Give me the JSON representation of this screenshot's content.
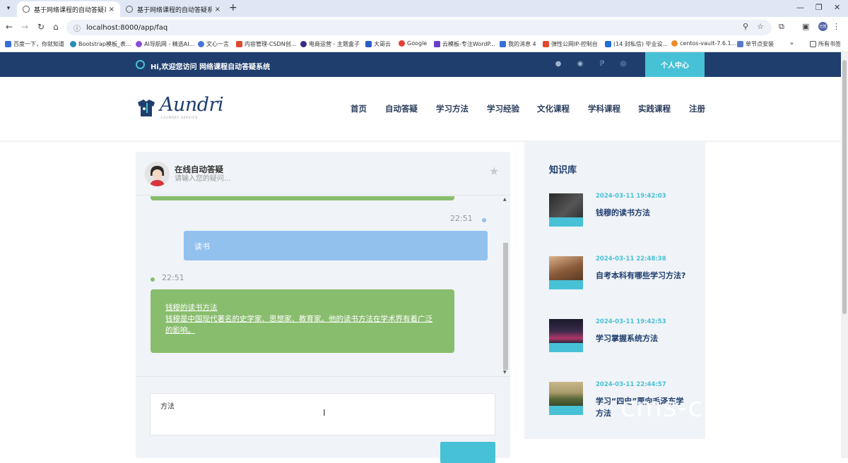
{
  "browser": {
    "tabs": [
      {
        "title": "基于网络课程的自动答疑系统",
        "active": true
      },
      {
        "title": "基于网络课程的自动答疑系统",
        "active": false
      }
    ],
    "new_tab": "+",
    "close": "×",
    "url": "localhost:8000/app/faq",
    "bookmarks": [
      "百度一下，你就知道",
      "Bootstrap模板_表...",
      "AI导航网 - 精选AI...",
      "文心一言",
      "内容管理-CSDN创...",
      "电商运营 - 主题盒子",
      "大哥云",
      "Google",
      "云模板-专注WordP...",
      "我的消息 4",
      "弹性公网IP-控制台",
      "(14 封私信) 毕业设...",
      "centos-vault-7.6.1...",
      "单节点安装"
    ],
    "bookmarks_more": "»",
    "all_bookmarks": "所有书签",
    "profile": "已暂"
  },
  "topbar": {
    "welcome": "Hi,欢迎您访问 网络课程自动答疑系统",
    "user_center": "个人中心",
    "social_icons": [
      "qq-icon",
      "wechat-icon",
      "pinterest-icon",
      "instagram-icon"
    ]
  },
  "header": {
    "logo_text": "Aundri",
    "logo_sub": "LAUNDRY SERVICE",
    "nav": [
      "首页",
      "自动答疑",
      "学习方法",
      "学习经验",
      "文化课程",
      "学科课程",
      "实践课程",
      "注册"
    ]
  },
  "chat": {
    "title": "在线自动答疑",
    "subtitle": "请输入您的疑问...",
    "messages": [
      {
        "side": "right",
        "time": "22:51",
        "text": "读书"
      },
      {
        "side": "left",
        "time": "22:51",
        "lines": [
          "钱穆的读书方法",
          "钱穆是中国现代著名的史学家、思想家、教育家。他的读书方法在学术界有着广泛的影响。"
        ]
      }
    ],
    "input_value": "方法"
  },
  "knowledge": {
    "title": "知识库",
    "items": [
      {
        "date": "2024-03-11 19:42:03",
        "title": "钱穆的读书方法"
      },
      {
        "date": "2024-03-11 22:48:38",
        "title": "自考本科有哪些学习方法?"
      },
      {
        "date": "2024-03-11 19:42:53",
        "title": "学习掌握系统方法"
      },
      {
        "date": "2024-03-11 22:44:57",
        "title": "学习“四史”要向毛泽东学方法"
      }
    ]
  },
  "watermark": "cms-c",
  "colors": {
    "accent": "#47c1d6",
    "navy": "#1f3e6e",
    "user_bubble": "#92c1ee",
    "bot_bubble": "#88bd6d"
  }
}
